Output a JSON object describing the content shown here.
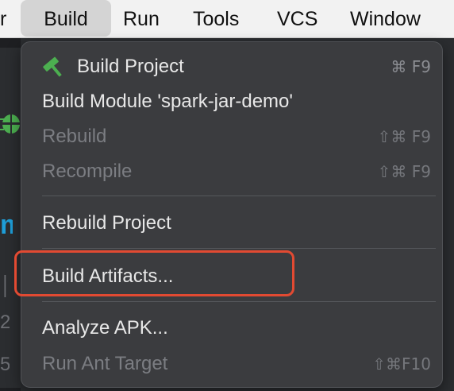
{
  "menubar": {
    "items": [
      {
        "label": "r",
        "active": false
      },
      {
        "label": "Build",
        "active": true
      },
      {
        "label": "Run",
        "active": false
      },
      {
        "label": "Tools",
        "active": false
      },
      {
        "label": "VCS",
        "active": false
      },
      {
        "label": "Window",
        "active": false
      }
    ]
  },
  "side": {
    "m_glyph": "m",
    "glyph_a": "│",
    "glyph_b": "2",
    "glyph_c": "5"
  },
  "build_menu": {
    "items": [
      {
        "label": "Build Project",
        "shortcut": "⌘ F9",
        "enabled": true,
        "icon": "hammer-icon"
      },
      {
        "label": "Build Module 'spark-jar-demo'",
        "shortcut": "",
        "enabled": true
      },
      {
        "label": "Rebuild",
        "shortcut": "⇧⌘ F9",
        "enabled": false
      },
      {
        "label": "Recompile",
        "shortcut": "⇧⌘ F9",
        "enabled": false
      },
      {
        "label": "Rebuild Project",
        "shortcut": "",
        "enabled": true
      },
      {
        "label": "Build Artifacts...",
        "shortcut": "",
        "enabled": true,
        "highlighted": true
      },
      {
        "label": "Analyze APK...",
        "shortcut": "",
        "enabled": true
      },
      {
        "label": "Run Ant Target",
        "shortcut": "⇧⌘F10",
        "enabled": false
      }
    ]
  },
  "colors": {
    "accent_green": "#4caf50",
    "highlight_red": "#e24a32",
    "menu_bg": "#3b3c3f"
  }
}
